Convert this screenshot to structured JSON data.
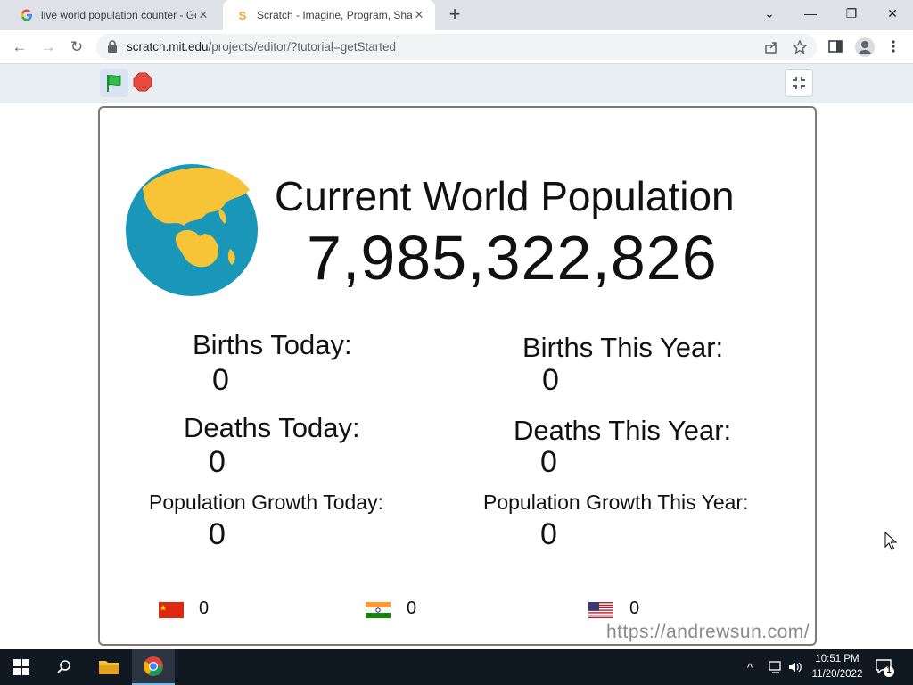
{
  "browser": {
    "tabs": [
      {
        "title": "live world population counter - Go",
        "favicon": "google-g-icon",
        "active": false
      },
      {
        "title": "Scratch - Imagine, Program, Shar",
        "favicon": "scratch-icon",
        "active": true
      }
    ],
    "url_host": "scratch.mit.edu",
    "url_path": "/projects/editor/?tutorial=getStarted"
  },
  "stage": {
    "headline": "Current World Population",
    "population": "7,985,322,826",
    "stats": {
      "births_today_label": "Births Today:",
      "births_today_value": "0",
      "births_year_label": "Births This Year:",
      "births_year_value": "0",
      "deaths_today_label": "Deaths Today:",
      "deaths_today_value": "0",
      "deaths_year_label": "Deaths This Year:",
      "deaths_year_value": "0",
      "growth_today_label": "Population Growth Today:",
      "growth_today_value": "0",
      "growth_year_label": "Population Growth This Year:",
      "growth_year_value": "0"
    },
    "countries": [
      {
        "name": "china-flag-icon",
        "value": "0"
      },
      {
        "name": "india-flag-icon",
        "value": "0"
      },
      {
        "name": "usa-flag-icon",
        "value": "0"
      }
    ],
    "watermark": "https://andrewsun.com/"
  },
  "taskbar": {
    "time": "10:51 PM",
    "date": "11/20/2022",
    "notification_count": "1"
  },
  "colors": {
    "globe_ocean": "#1996b8",
    "globe_land": "#f8c437",
    "flag_green": "#2fbf4a",
    "stop_red": "#e84a3f",
    "taskbar_bg": "#101822"
  }
}
